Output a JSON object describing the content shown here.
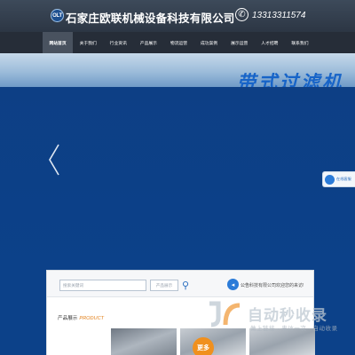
{
  "header": {
    "logo_text": "OLT",
    "company_name": "石家庄欧联机械设备科技有限公司",
    "phone_icon": "phone-icon",
    "phone": "13313311574"
  },
  "nav": {
    "items": [
      {
        "label": "网站首页",
        "active": true
      },
      {
        "label": "关于我们",
        "active": false
      },
      {
        "label": "行业资讯",
        "active": false
      },
      {
        "label": "产品展示",
        "active": false
      },
      {
        "label": "物流运营",
        "active": false
      },
      {
        "label": "成功案例",
        "active": false
      },
      {
        "label": "展示运营",
        "active": false
      },
      {
        "label": "人才招聘",
        "active": false
      },
      {
        "label": "联系我们",
        "active": false
      }
    ]
  },
  "banner": {
    "title": "带式过滤机",
    "prev_icon": "chevron-left-icon"
  },
  "online_service": {
    "label": "在线客服"
  },
  "search": {
    "placeholder": "搜索关键词",
    "category": "产品展示",
    "button_icon": "search-icon"
  },
  "notice": {
    "label": "公告:",
    "text": "科技有限公司欢迎您的来访!"
  },
  "products": {
    "heading": "产品展示",
    "heading_en": "PRODUCT",
    "badge": "更多"
  },
  "watermark": {
    "title": "自动秒收录",
    "subtitle": "做上链接 · 来访一次 · 自动收录"
  },
  "colors": {
    "header_bg": "#2c3644",
    "nav_bg": "#262d38",
    "banner_blue": "#0c4189",
    "banner_title": "#1764c8",
    "accent_orange": "#e27f18"
  }
}
